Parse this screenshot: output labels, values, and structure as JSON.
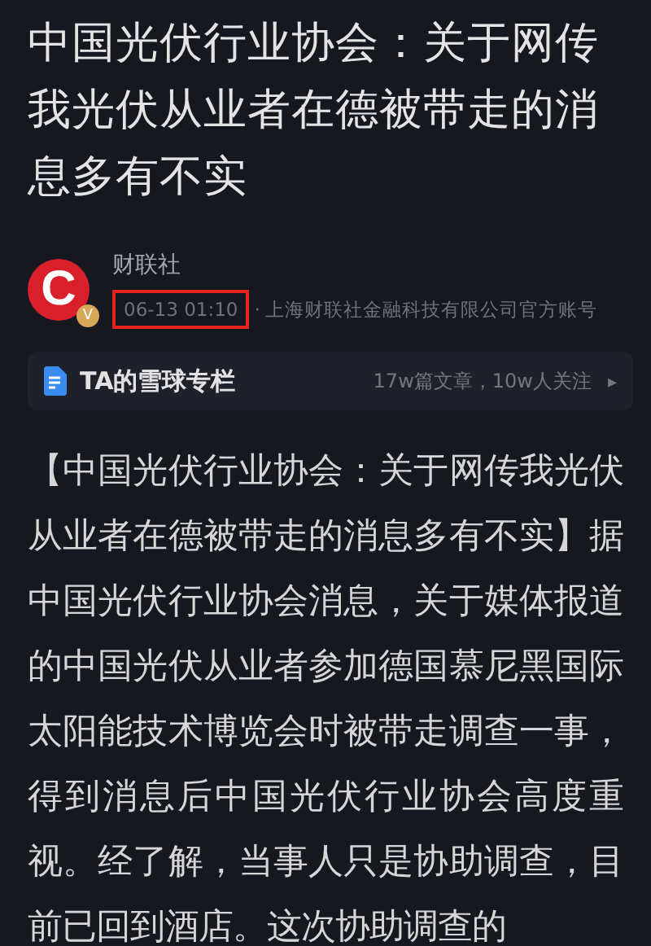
{
  "article": {
    "title": "中国光伏行业协会：关于网传我光伏从业者在德被带走的消息多有不实",
    "author": {
      "avatar_letter": "C",
      "verified_mark": "V",
      "name": "财联社",
      "time": "06-13 01:10",
      "time_highlighted": true,
      "separator": "·",
      "description": "上海财联社金融科技有限公司官方账号"
    },
    "column_card": {
      "title": "TA的雪球专栏",
      "stats": "17w篇文章，10w人关注",
      "arrow": "▸"
    },
    "body": "【中国光伏行业协会：关于网传我光伏从业者在德被带走的消息多有不实】据中国光伏行业协会消息，关于媒体报道的中国光伏从业者参加德国慕尼黑国际太阳能技术博览会时被带走调查一事，得到消息后中国光伏行业协会高度重视。经了解，当事人只是协助调查，目前已回到酒店。这次协助调查的"
  }
}
